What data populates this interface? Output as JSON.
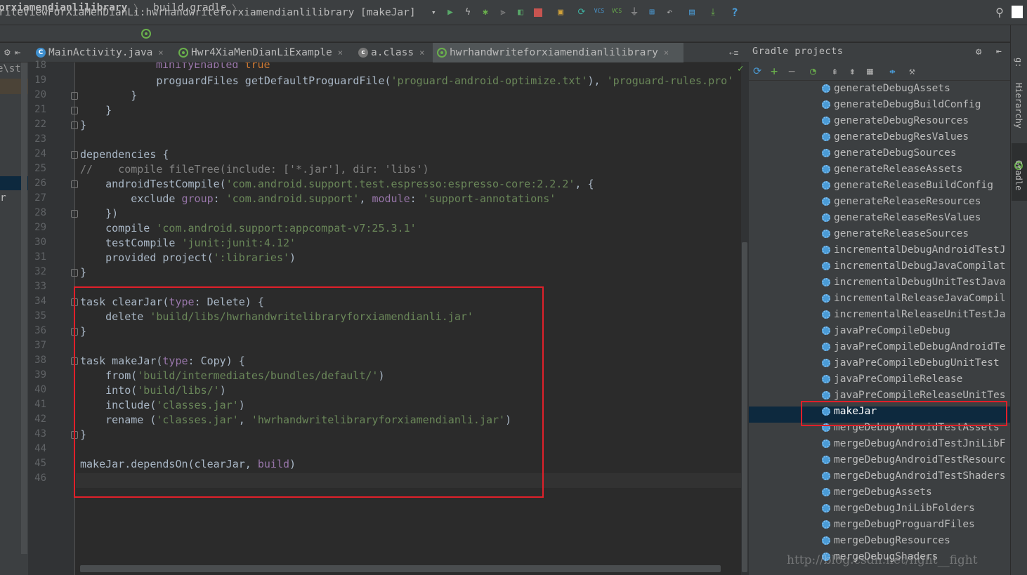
{
  "toolbar": {
    "run_config": "riteViewForXiaMenDianLi:hwrhandwriteforxiamendianlilibrary [makeJar]",
    "icons": [
      "run-icon",
      "flash-icon",
      "debug-icon",
      "attach-icon",
      "coverage-icon",
      "stop-icon",
      "avd-manager-icon",
      "sync-icon",
      "vcs-update-icon",
      "vcs-commit-icon",
      "vcs-history-icon",
      "project-structure-icon",
      "revert-icon",
      "sdk-manager-icon",
      "download-icon",
      "help-icon",
      "search-icon"
    ],
    "vcs_label": "VCS",
    "help_glyph": "?",
    "search_glyph": "⚲"
  },
  "navbar": {
    "crumb1": "orxiamendianlilibrary",
    "crumb2": "build.gradle",
    "sep": "〉"
  },
  "tabs": [
    {
      "label": "MainActivity.java",
      "icon": "C"
    },
    {
      "label": "Hwr4XiaMenDianLiExample",
      "icon": "gradle"
    },
    {
      "label": "a.class",
      "icon": "class"
    },
    {
      "label": "hwrhandwriteforxiamendianlilibrary",
      "icon": "gradle"
    }
  ],
  "tab_close": "×",
  "tab_overflow": "⇠≡",
  "left_strip": {
    "text": "e\\st",
    "r": "r"
  },
  "editor": {
    "line_numbers": [
      "18",
      "19",
      "20",
      "21",
      "22",
      "23",
      "24",
      "25",
      "26",
      "27",
      "28",
      "29",
      "30",
      "31",
      "32",
      "33",
      "34",
      "35",
      "36",
      "37",
      "38",
      "39",
      "40",
      "41",
      "42",
      "43",
      "44",
      "45",
      "46"
    ]
  },
  "gradle": {
    "title": "Gradle projects",
    "settings_glyph": "⚙",
    "hide_glyph": "⇤",
    "tasks": [
      "generateDebugAssets",
      "generateDebugBuildConfig",
      "generateDebugResources",
      "generateDebugResValues",
      "generateDebugSources",
      "generateReleaseAssets",
      "generateReleaseBuildConfig",
      "generateReleaseResources",
      "generateReleaseResValues",
      "generateReleaseSources",
      "incrementalDebugAndroidTestJ",
      "incrementalDebugJavaCompilat",
      "incrementalDebugUnitTestJava",
      "incrementalReleaseJavaCompil",
      "incrementalReleaseUnitTestJa",
      "javaPreCompileDebug",
      "javaPreCompileDebugAndroidTe",
      "javaPreCompileDebugUnitTest",
      "javaPreCompileRelease",
      "javaPreCompileReleaseUnitTes",
      "makeJar",
      "mergeDebugAndroidTestAssets",
      "mergeDebugAndroidTestJniLibF",
      "mergeDebugAndroidTestResourc",
      "mergeDebugAndroidTestShaders",
      "mergeDebugAssets",
      "mergeDebugJniLibFolders",
      "mergeDebugProguardFiles",
      "mergeDebugResources",
      "mergeDebugShaders"
    ],
    "selected_task": "makeJar"
  },
  "right_strip": {
    "hierarchy": "Hierarchy",
    "gradle": "Gradle",
    "top": "g:"
  },
  "watermark": "http://blog.csdn.net/fight__fight",
  "colors": {
    "highlight_box": "#e0202a",
    "selection": "#0d293e",
    "string": "#6a8759",
    "keyword": "#cc7832",
    "param": "#9876aa"
  }
}
